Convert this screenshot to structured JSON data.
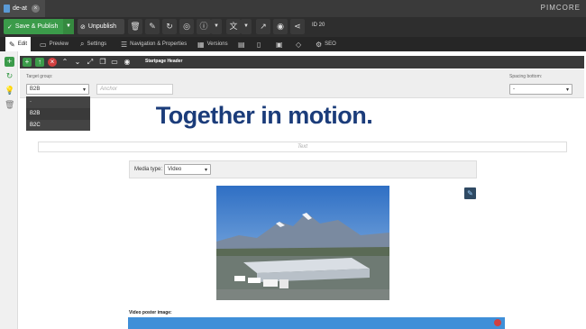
{
  "tab": {
    "label": "de-at"
  },
  "brand": "PIMCORE",
  "toolbar": {
    "save_publish": "Save & Publish",
    "unpublish": "Unpublish",
    "id": "ID 20"
  },
  "tabs": [
    {
      "label": "Edit"
    },
    {
      "label": "Preview"
    },
    {
      "label": "Settings"
    },
    {
      "label": "Navigation & Properties"
    },
    {
      "label": "Versions"
    },
    {
      "label": "SEO"
    }
  ],
  "editable": {
    "block_label": "Startpage Header"
  },
  "settings": {
    "target_group_label": "Target group:",
    "target_group_value": "B2B",
    "anchor_placeholder": "Anchor",
    "spacing_label": "Spacing bottom:",
    "spacing_value": "-"
  },
  "dropdown": {
    "options": [
      "-",
      "B2B",
      "B2C"
    ]
  },
  "content": {
    "headline": "Together in motion.",
    "text_placeholder": "Text",
    "media_type_label": "Media type:",
    "media_type_value": "Video",
    "poster_label": "Video poster image:"
  },
  "colors": {
    "accent_green": "#3b9b4a",
    "headline_blue": "#1b3c7a",
    "dark_bar": "#2e2e2e"
  }
}
